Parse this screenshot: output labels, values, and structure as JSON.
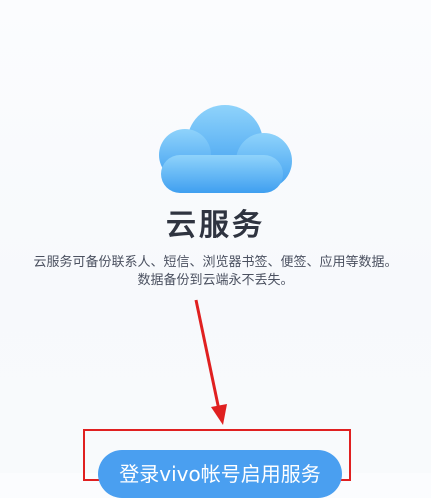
{
  "app": {
    "title": "云服务",
    "description_line1": "云服务可备份联系人、短信、浏览器书签、便签、应用等数据。",
    "description_line2": "数据备份到云端永不丢失。",
    "icon": "cloud-icon"
  },
  "actions": {
    "login_button_label": "登录vivo帐号启用服务"
  },
  "colors": {
    "cloud_top": "#8fd3fb",
    "cloud_bottom": "#3f9ff0",
    "button": "#4a9ff0",
    "annotation": "#e02020"
  }
}
